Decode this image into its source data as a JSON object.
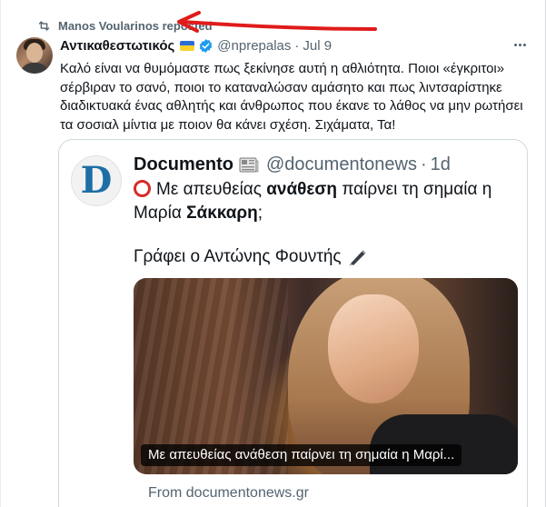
{
  "repost": {
    "text": "Manos Voularinos reposted",
    "icon": "repost-icon"
  },
  "tweet": {
    "author_name": "Αντικαθεστωτικός",
    "handle": "@nprepalas",
    "separator": "·",
    "date": "Jul 9",
    "text": "Καλό είναι να θυμόμαστε πως ξεκίνησε αυτή η αθλιότητα. Ποιοι «έγκριτοι» σέρβιραν το σανό, ποιοι το καταναλώσαν αμάσητο και πως λιντσαρίστηκε διαδικτυακά ένας αθλητής και άνθρωπος που έκανε το λάθος να μην ρωτήσει τα σοσιαλ μίντια με ποιον θα κάνει σχέση. Σιχάματα, Τα!"
  },
  "quoted": {
    "avatar_letter": "D",
    "name": "Documento",
    "handle": "@documentonews",
    "separator": "·",
    "date": "1d",
    "text_part1": "Με απευθείας ",
    "text_bold1": "ανάθεση",
    "text_part2": " παίρνει τη σημαία η Μαρία ",
    "text_bold2": "Σάκκαρη",
    "text_part3": ";",
    "text_line2": "Γράφει ο Αντώνης Φουντής",
    "media_caption": "Με απευθείας ανάθεση παίρνει τη σημαία η Μαρί...",
    "from_link": "From documentonews.gr"
  },
  "colors": {
    "accent_blue": "#1d9bf0",
    "secondary_text": "#536471",
    "annotation_red": "#e01b1b",
    "red_circle": "#d62b2b"
  }
}
